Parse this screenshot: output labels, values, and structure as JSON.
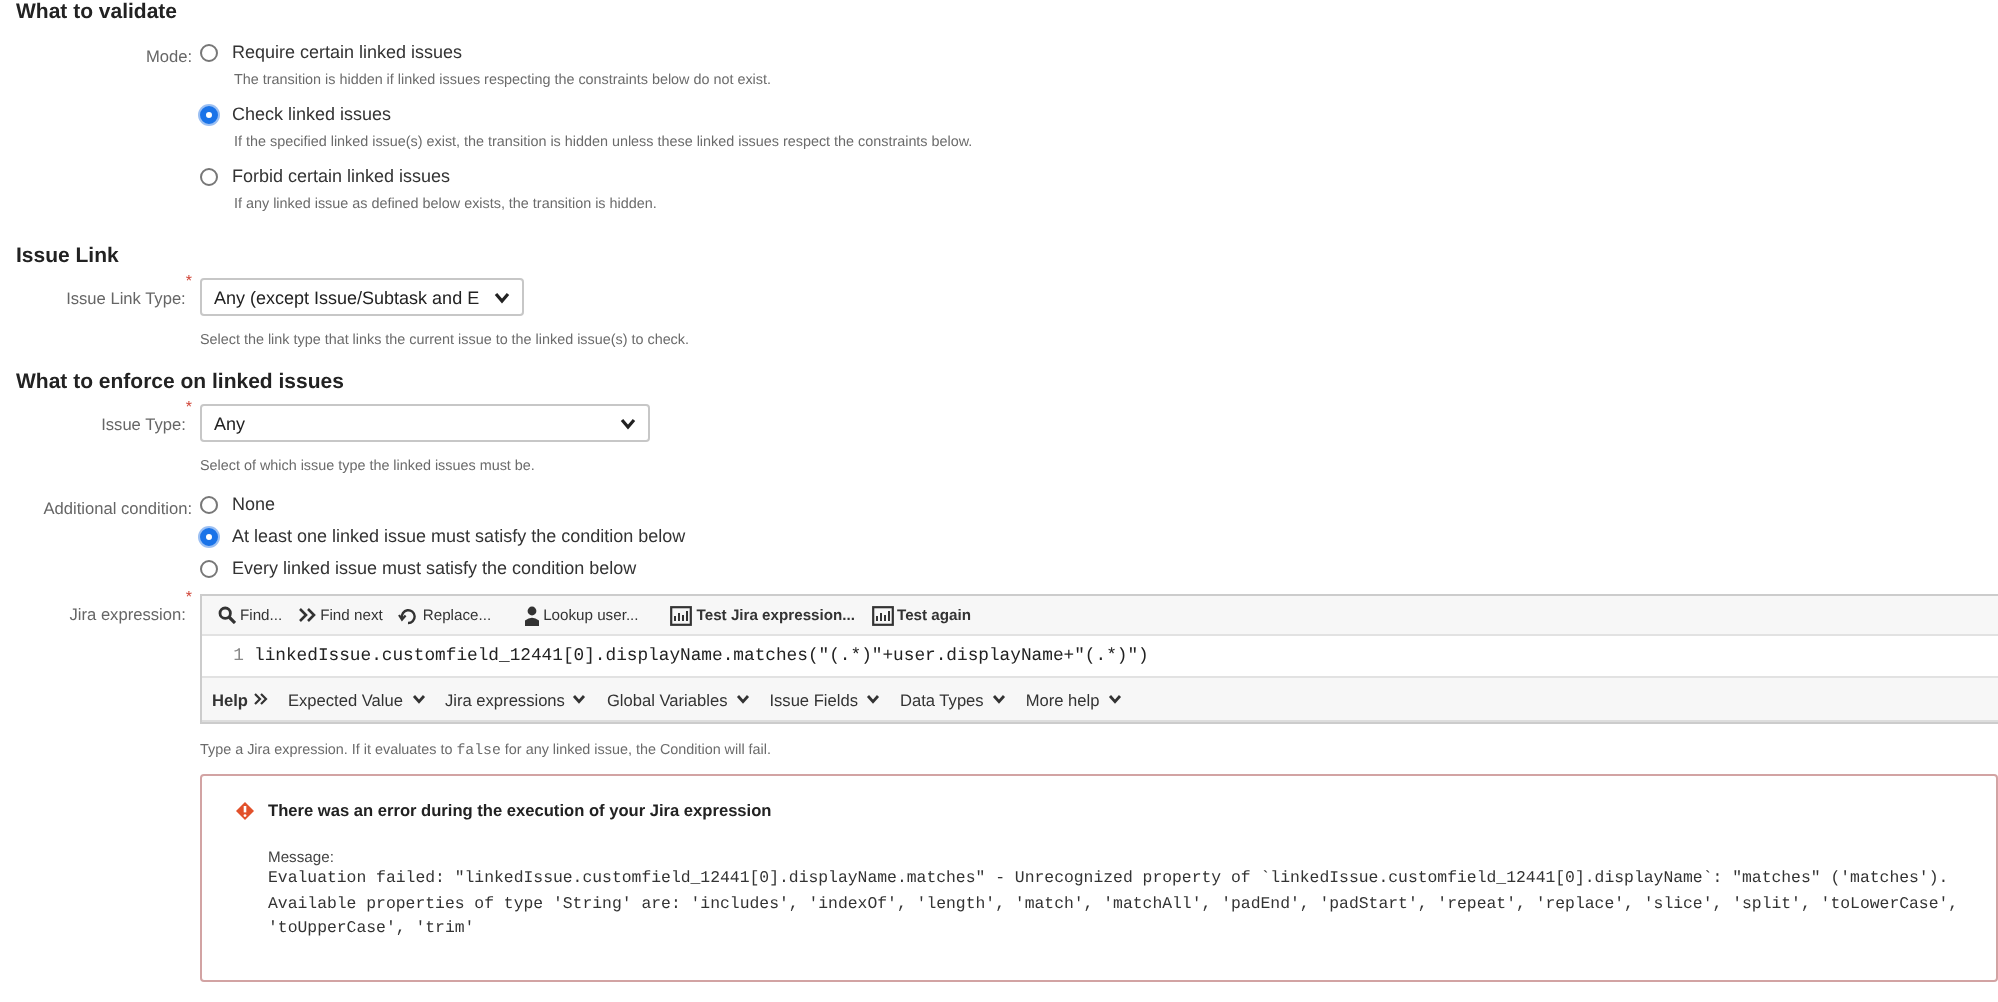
{
  "validate": {
    "heading": "What to validate",
    "mode": {
      "label": "Mode:",
      "options": [
        {
          "label": "Require certain linked issues",
          "description": "The transition is hidden if linked issues respecting the constraints below do not exist.",
          "selected": false
        },
        {
          "label": "Check linked issues",
          "description": "If the specified linked issue(s) exist, the transition is hidden unless these linked issues respect the constraints below.",
          "selected": true
        },
        {
          "label": "Forbid certain linked issues",
          "description": "If any linked issue as defined below exists, the transition is hidden.",
          "selected": false
        }
      ]
    }
  },
  "issue_link": {
    "heading": "Issue Link",
    "link_type": {
      "label": "Issue Link Type:",
      "required_mark": "*",
      "value": "Any (except Issue/Subtask and E",
      "hint": "Select the link type that links the current issue to the linked issue(s) to check."
    }
  },
  "enforce": {
    "heading": "What to enforce on linked issues",
    "issue_type": {
      "label": "Issue Type:",
      "required_mark": "*",
      "value": "Any",
      "hint": "Select of which issue type the linked issues must be."
    },
    "additional_condition": {
      "label": "Additional condition:",
      "options": [
        {
          "label": "None",
          "selected": false
        },
        {
          "label": "At least one linked issue must satisfy the condition below",
          "selected": true
        },
        {
          "label": "Every linked issue must satisfy the condition below",
          "selected": false
        }
      ]
    },
    "jira_expression": {
      "label": "Jira expression:",
      "required_mark": "*",
      "toolbar": [
        {
          "label": "Find...",
          "bold": false
        },
        {
          "label": "Find next",
          "bold": false
        },
        {
          "label": "Replace...",
          "bold": false
        },
        {
          "label": "Lookup user...",
          "bold": false
        },
        {
          "label": "Test Jira expression...",
          "bold": true
        },
        {
          "label": "Test again",
          "bold": true
        }
      ],
      "line_number": "1",
      "code": "linkedIssue.customfield_12441[0].displayName.matches(\"(.*)\"+user.displayName+\"(.*)\")",
      "help_bar": [
        {
          "label": "Help",
          "kind": "heading"
        },
        {
          "label": "Expected Value",
          "kind": "menu"
        },
        {
          "label": "Jira expressions",
          "kind": "menu"
        },
        {
          "label": "Global Variables",
          "kind": "menu"
        },
        {
          "label": "Issue Fields",
          "kind": "menu"
        },
        {
          "label": "Data Types",
          "kind": "menu"
        },
        {
          "label": "More help",
          "kind": "menu"
        }
      ],
      "hint_before": "Type a Jira expression. If it evaluates to",
      "hint_code": "false",
      "hint_after": "for any linked issue, the Condition will fail."
    }
  },
  "error": {
    "title": "There was an error during the execution of your Jira expression",
    "message_label": "Message:",
    "message_lines": [
      "Evaluation failed: \"linkedIssue.customfield_12441[0].displayName.matches\" - Unrecognized property of `linkedIssue.customfield_12441[0].displayName`: \"matches\" ('matches').",
      "Available properties of type 'String' are: 'includes', 'indexOf', 'length', 'match', 'matchAll', 'padEnd', 'padStart', 'repeat', 'replace', 'slice', 'split', 'toLowerCase',",
      "'toUpperCase', 'trim'"
    ]
  }
}
